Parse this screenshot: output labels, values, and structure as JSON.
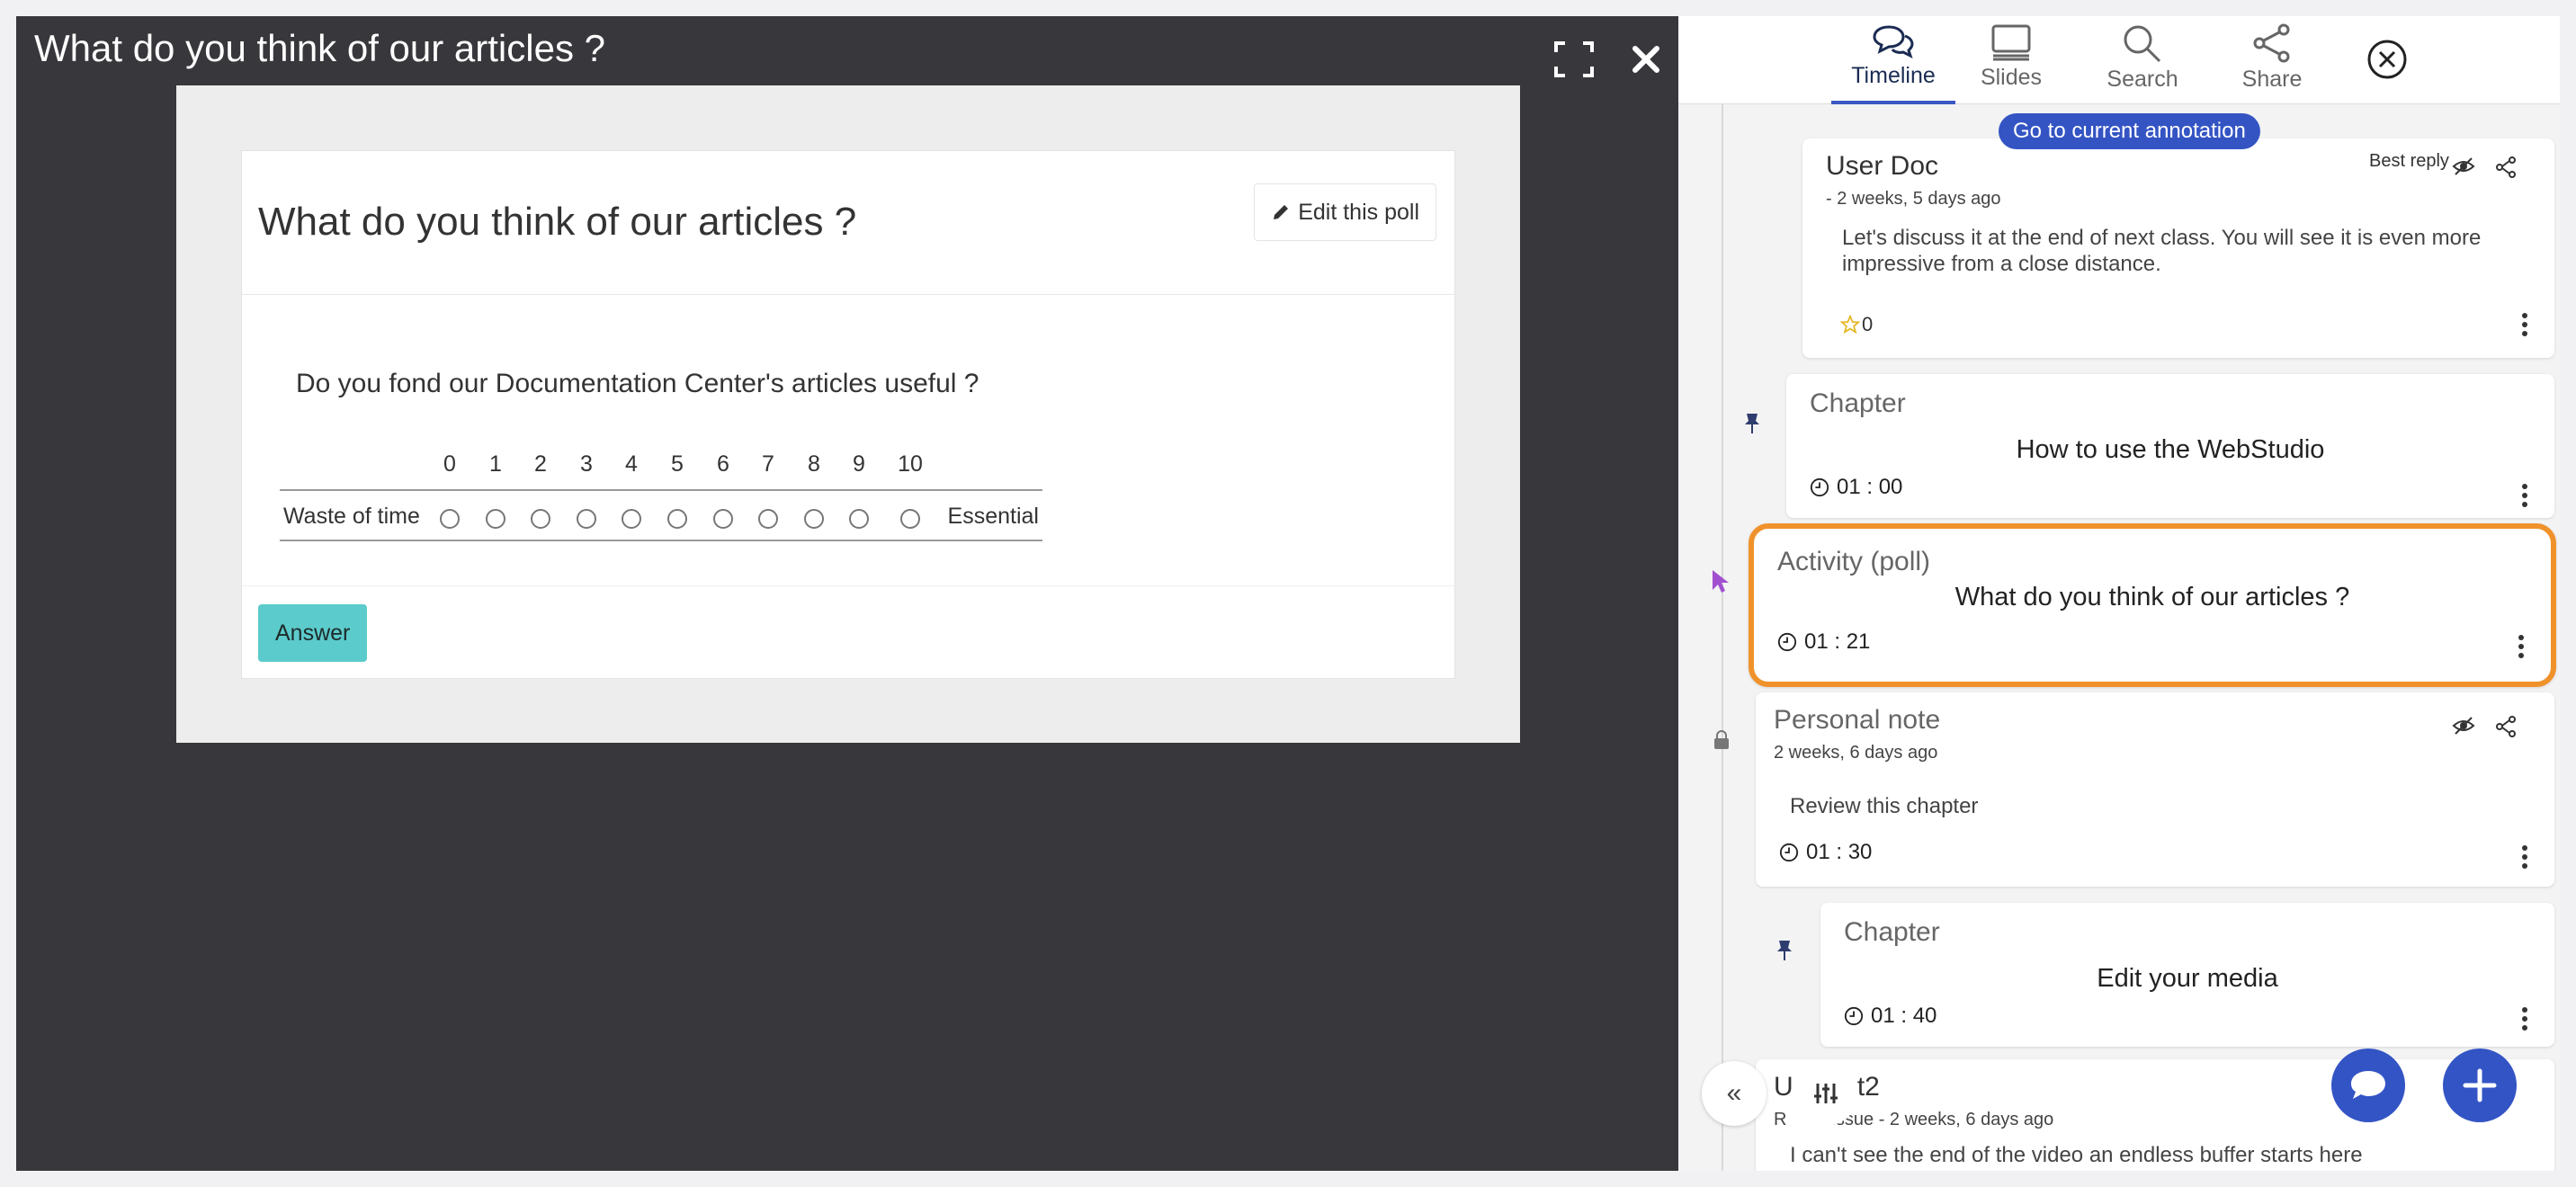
{
  "player": {
    "title": "What do you think of our articles ?",
    "fullscreen_icon": "fullscreen-icon",
    "close_icon": "close-icon"
  },
  "poll": {
    "heading": "What do you think of our articles ?",
    "edit_label": "Edit this poll",
    "question": "Do you fond our Documentation Center's articles useful ?",
    "scale_numbers": [
      "0",
      "1",
      "2",
      "3",
      "4",
      "5",
      "6",
      "7",
      "8",
      "9",
      "10"
    ],
    "left_label": "Waste of time",
    "right_label": "Essential",
    "answer_label": "Answer"
  },
  "tabs": [
    {
      "label": "Timeline",
      "icon": "comments-icon",
      "active": true
    },
    {
      "label": "Slides",
      "icon": "slides-icon"
    },
    {
      "label": "Search",
      "icon": "search-icon"
    },
    {
      "label": "Share",
      "icon": "share-icon"
    }
  ],
  "goto_label": "Go to current annotation",
  "cards": {
    "reply": {
      "user": "User Doc",
      "meta": "- 2 weeks, 5 days ago",
      "best_reply": "Best reply",
      "text": "Let's discuss it at the end of next class. You will see it is even more impressive from a close distance.",
      "stars": "0"
    },
    "chapter1": {
      "type": "Chapter",
      "title": "How to use the WebStudio",
      "time": "01 : 00"
    },
    "activity": {
      "type": "Activity (poll)",
      "title": "What do you think of our articles ?",
      "time": "01 : 21"
    },
    "note": {
      "type": "Personal note",
      "meta": "2 weeks, 6 days ago",
      "text": "Review this chapter",
      "time": "01 : 30"
    },
    "chapter2": {
      "type": "Chapter",
      "title": "Edit your media",
      "time": "01 : 40"
    },
    "bottom": {
      "user": "U   Test2",
      "meta": "R         issue - 2 weeks, 6 days ago",
      "text": "I can't see the end of the video an endless buffer starts here"
    }
  },
  "colors": {
    "accent": "#3454c4",
    "highlight": "#f0922b",
    "answer": "#5ccbcb",
    "player_bg": "#38373c"
  }
}
